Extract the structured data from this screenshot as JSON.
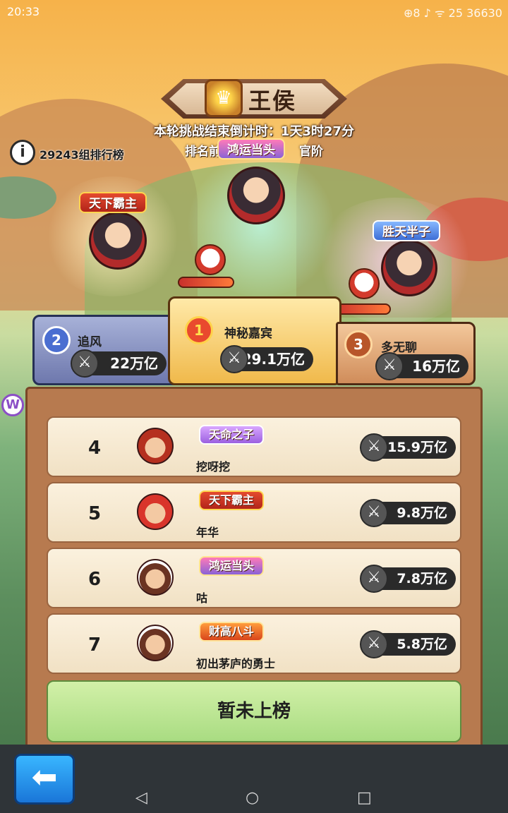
{
  "status_bar": {
    "time": "20:33",
    "right_text": "⊕8 ♪ ᯤ 25 36630"
  },
  "header": {
    "title": "王侯",
    "countdown": "本轮挑战结束倒计时：1天3时27分",
    "reward_left": "排名前",
    "reward_right": "官阶",
    "emblem_icon": "crown-emblem-icon"
  },
  "group": {
    "count_label": "29243组排行榜"
  },
  "scene_badges": {
    "rank2": "天下霸主",
    "rank1": "鸿运当头",
    "rank3": "胜天半子"
  },
  "podium": [
    {
      "rank": "2",
      "name": "追风",
      "power": "22万亿"
    },
    {
      "rank": "1",
      "name": "神秘嘉宾",
      "power": "29.1万亿"
    },
    {
      "rank": "3",
      "name": "多无聊",
      "power": "16万亿"
    }
  ],
  "rows": [
    {
      "rank": "4",
      "badge": "天命之子",
      "name": "挖呀挖",
      "power": "15.9万亿"
    },
    {
      "rank": "5",
      "badge": "天下霸主",
      "name": "年华",
      "power": "9.8万亿"
    },
    {
      "rank": "6",
      "badge": "鸿运当头",
      "name": "咕",
      "power": "7.8万亿"
    },
    {
      "rank": "7",
      "badge": "财高八斗",
      "name": "初出茅庐的勇士",
      "power": "5.8万亿"
    }
  ],
  "my_status": "暂未上榜",
  "side_button": "W",
  "icons": {
    "sword": "sword-icon",
    "back": "back-arrow-icon",
    "info": "info-icon"
  },
  "colors": {
    "gold": "#f0b94b",
    "silver": "#6e78ad",
    "bronze": "#d08c5a",
    "green": "#a9dc82"
  }
}
